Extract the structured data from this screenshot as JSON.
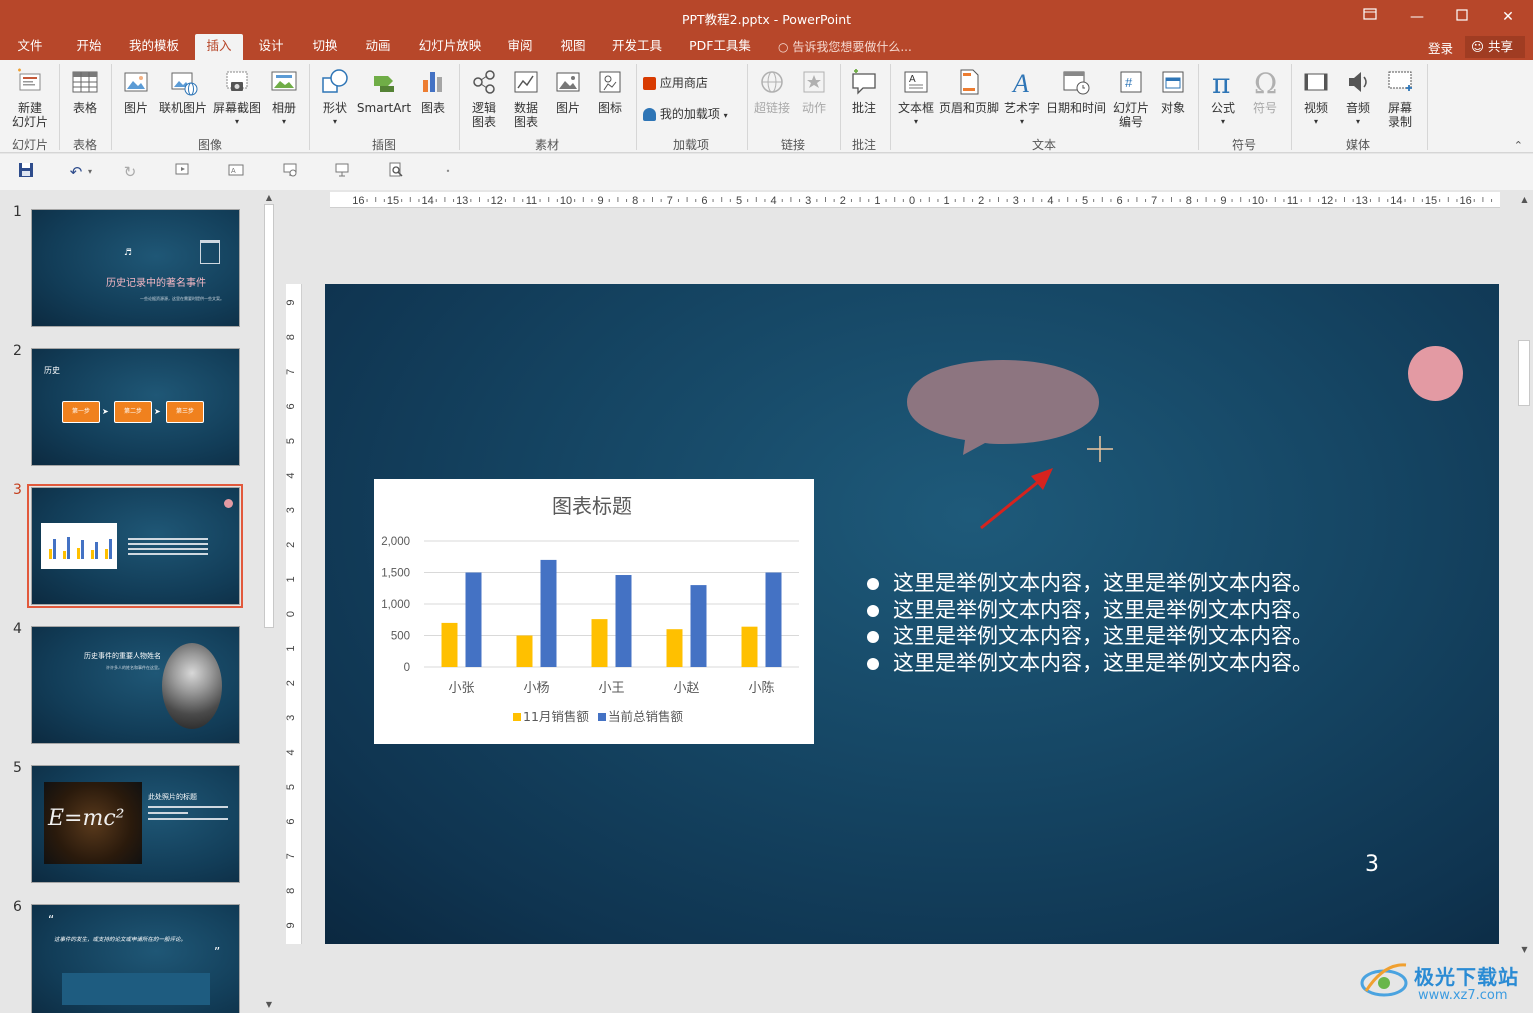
{
  "app": {
    "title": "PPT教程2.pptx - PowerPoint",
    "window_buttons": [
      "restore-ribbon-icon",
      "minimize-icon",
      "maximize-icon",
      "close-icon"
    ]
  },
  "tabs": [
    "文件",
    "开始",
    "我的模板",
    "插入",
    "设计",
    "切换",
    "动画",
    "幻灯片放映",
    "审阅",
    "视图",
    "开发工具",
    "PDF工具集"
  ],
  "active_tab": "插入",
  "tell_me": "告诉我您想要做什么...",
  "login": "登录",
  "share": "共享",
  "ribbon": {
    "new_slide": "新建\n幻灯片",
    "table": "表格",
    "picture": "图片",
    "online_picture": "联机图片",
    "screenshot": "屏幕截图",
    "album": "相册",
    "shapes": "形状",
    "smartart": "SmartArt",
    "chart": "图表",
    "logic_chart": "逻辑\n图表",
    "data_chart": "数据\n图表",
    "material_picture": "图片",
    "material_icon": "图标",
    "app_store": "应用商店",
    "my_addins": "我的加载项",
    "hyperlink": "超链接",
    "action": "动作",
    "comment": "批注",
    "textbox": "文本框",
    "header_footer": "页眉和页脚",
    "wordart": "艺术字",
    "datetime": "日期和时间",
    "slide_number": "幻灯片\n编号",
    "object": "对象",
    "equation": "公式",
    "symbol": "符号",
    "video": "视频",
    "audio": "音频",
    "screen_record": "屏幕\n录制",
    "groups": {
      "slides": "幻灯片",
      "tables": "表格",
      "images": "图像",
      "illustrations": "插图",
      "material": "素材",
      "addins": "加载项",
      "links": "链接",
      "comments": "批注",
      "text": "文本",
      "symbols": "符号",
      "media": "媒体"
    }
  },
  "thumbnails": {
    "numbers": [
      "1",
      "2",
      "3",
      "4",
      "5",
      "6"
    ],
    "t1_title": "历史记录中的著名事件",
    "t1_sub": "一些论据资源源，这里在需要时提供一些文案。",
    "t2_title": "历史",
    "t2_steps": [
      "第一步",
      "第二步",
      "第三步"
    ],
    "t4_title": "历史事件的重要人物姓名",
    "t4_sub": "许许多人的姓名和事件在这里。",
    "t5_title": "此处照片的标题",
    "t5_formula": "E=mc²",
    "t6_quote": "这事件的发生，或支持的论文或申请所在的一般评论。"
  },
  "slide": {
    "bullets": [
      "这里是举例文本内容，这里是举例文本内容。",
      "这里是举例文本内容，这里是举例文本内容。",
      "这里是举例文本内容，这里是举例文本内容。",
      "这里是举例文本内容，这里是举例文本内容。"
    ],
    "number": "3"
  },
  "chart_data": {
    "type": "bar",
    "title": "图表标题",
    "categories": [
      "小张",
      "小杨",
      "小王",
      "小赵",
      "小陈"
    ],
    "series": [
      {
        "name": "11月销售额",
        "color": "#ffc000",
        "values": [
          700,
          500,
          760,
          600,
          640
        ]
      },
      {
        "name": "当前总销售额",
        "color": "#4472c4",
        "values": [
          1500,
          1700,
          1460,
          1300,
          1500
        ]
      }
    ],
    "yticks": [
      "0",
      "500",
      "1,000",
      "1,500",
      "2,000"
    ],
    "ylim": [
      0,
      2000
    ],
    "legend": "bottom",
    "grid": true
  },
  "watermark": {
    "line1": "极光下载站",
    "line2": "www.xz7.com"
  }
}
